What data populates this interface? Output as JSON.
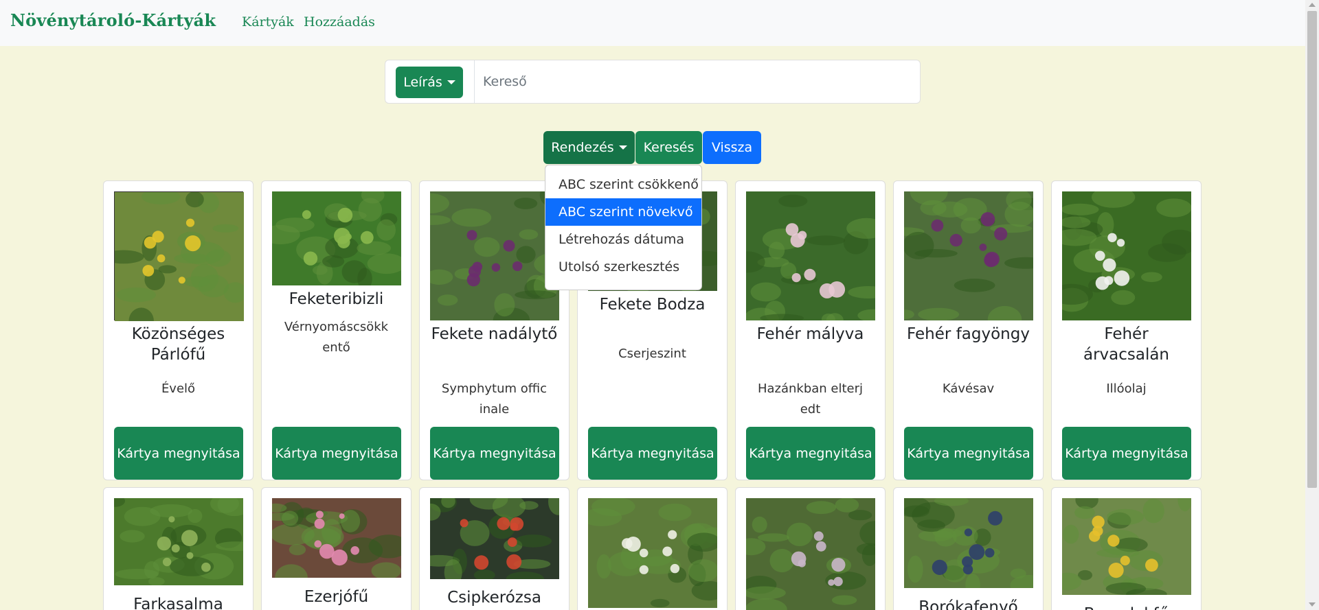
{
  "navbar": {
    "brand": "Növénytároló-Kártyák",
    "links": [
      "Kártyák",
      "Hozzáadás"
    ]
  },
  "search": {
    "field_dropdown_label": "Leírás",
    "placeholder": "Kereső",
    "value": ""
  },
  "controls": {
    "sort_label": "Rendezés",
    "search_label": "Keresés",
    "back_label": "Vissza"
  },
  "sort_menu": {
    "items": [
      "ABC szerint csökkenő",
      "ABC szerint növekvő",
      "Létrehozás dátuma",
      "Utolsó szerkesztés"
    ],
    "active_index": 1
  },
  "card_button_label": "Kártya megnyitása",
  "cards_row1": [
    {
      "title": "Közönséges Párlófű",
      "text": "Évelő",
      "img_color": "#6f8a3c",
      "img_accent": "#e3c52b"
    },
    {
      "title": "Feketeribizli",
      "text": "Vérnyomáscsökkentő",
      "img_color": "#3f7a2a",
      "img_accent": "#8ab84d"
    },
    {
      "title": "Fekete nadálytő",
      "text": "Symphytum officinale",
      "img_color": "#4e6e3a",
      "img_accent": "#6b2c6e"
    },
    {
      "title": "Fekete Bodza",
      "text": "Cserjeszint",
      "img_color": "#3c5e2b",
      "img_accent": "#dfe5d6"
    },
    {
      "title": "Fehér mályva",
      "text": "Hazánkban elterjedt",
      "img_color": "#3b6a2a",
      "img_accent": "#e8c8d4"
    },
    {
      "title": "Fehér fagyöngy",
      "text": "Kávésav",
      "img_color": "#4e6e3a",
      "img_accent": "#6b2c6e"
    },
    {
      "title": "Fehér árvacsalán",
      "text": "Illóolaj",
      "img_color": "#3a6b23",
      "img_accent": "#f2f2ef"
    }
  ],
  "cards_row2": [
    {
      "title": "Farkasalma",
      "img_color": "#4c7a2c",
      "img_accent": "#8fb35a"
    },
    {
      "title": "Ezerjófű",
      "img_color": "#6b4a3a",
      "img_accent": "#e38ab0"
    },
    {
      "title": "Csipkerózsa",
      "img_color": "#2c3a2a",
      "img_accent": "#d2472f"
    },
    {
      "title": "",
      "img_color": "#5d7b3a",
      "img_accent": "#eef0e6"
    },
    {
      "title": "",
      "img_color": "#4f6a34",
      "img_accent": "#c9b7c9"
    },
    {
      "title": "Borókafenyő",
      "img_color": "#5b7a3c",
      "img_accent": "#2e3f6a"
    },
    {
      "title": "Benedekfű",
      "img_color": "#6f8a4a",
      "img_accent": "#e6c02c"
    }
  ]
}
